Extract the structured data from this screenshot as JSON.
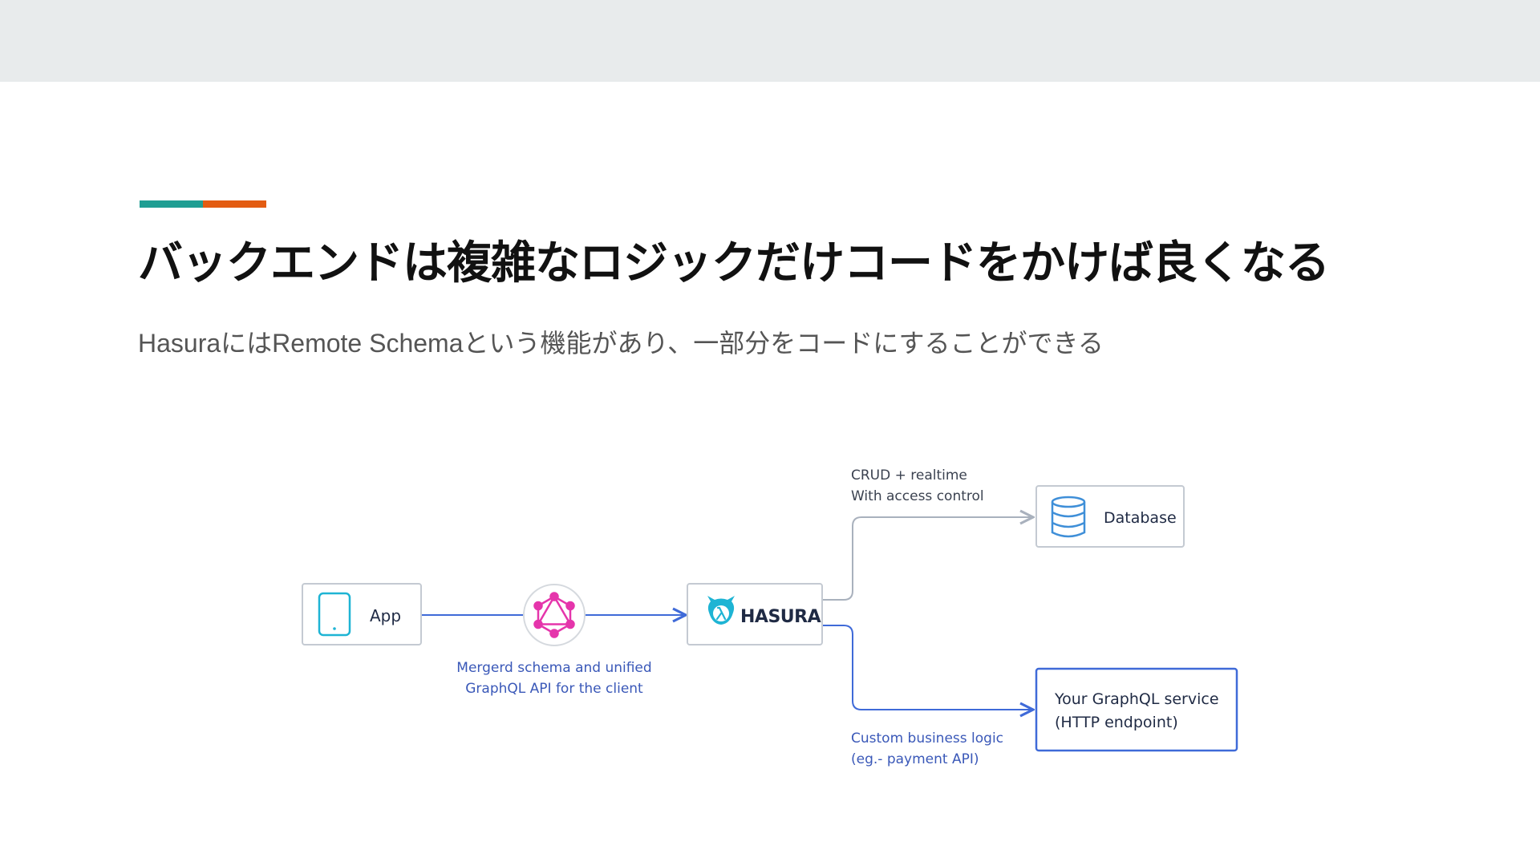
{
  "slide": {
    "title": "バックエンドは複雑なロジックだけコードをかけば良くなる",
    "subtitle": "HasuraにはRemote Schemaという機能があり、一部分をコードにすることができる"
  },
  "colors": {
    "accent_teal": "#1f9e93",
    "accent_orange": "#e35c12",
    "line_gray": "#a9b1bd",
    "line_blue": "#3f6ad8",
    "graphql_pink": "#e535ab",
    "hasura_teal": "#1eb4d4",
    "database_blue": "#3f8fd8"
  },
  "diagram": {
    "app": {
      "label": "App",
      "icon": "tablet-icon"
    },
    "graphql": {
      "icon": "graphql-icon",
      "caption_line1": "Mergerd schema and unified",
      "caption_line2": "GraphQL API for the client"
    },
    "hasura": {
      "label": "HASURA",
      "icon": "hasura-logo-icon"
    },
    "database": {
      "label": "Database",
      "icon": "database-icon",
      "caption_line1": "CRUD + realtime",
      "caption_line2": "With access control"
    },
    "service": {
      "label_line1": "Your GraphQL service",
      "label_line2": "(HTTP endpoint)",
      "caption_line1": "Custom business logic",
      "caption_line2": "(eg.- payment API)"
    }
  }
}
